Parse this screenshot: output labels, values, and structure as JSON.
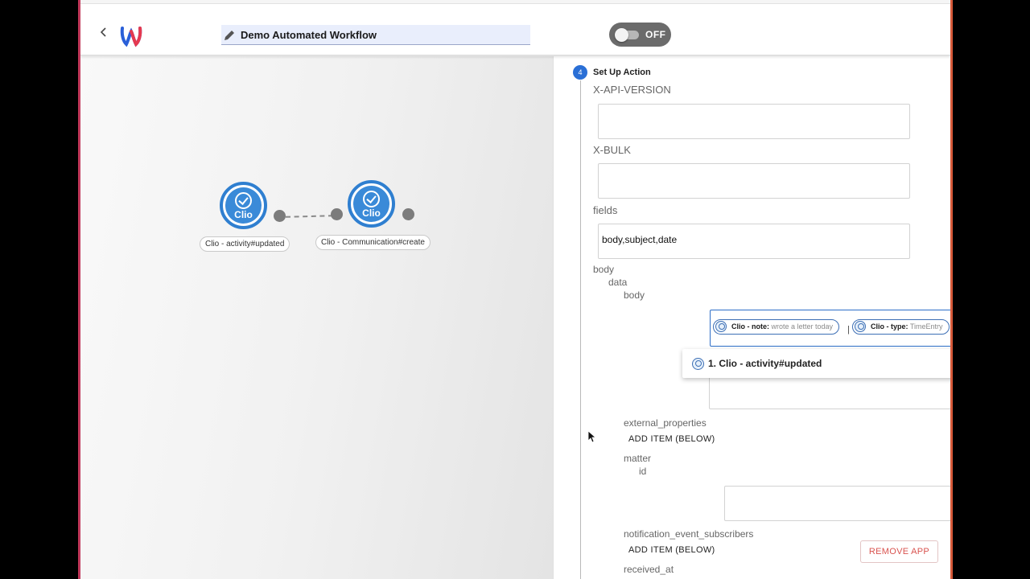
{
  "header": {
    "title_value": "Demo Automated Workflow",
    "toggle_label": "OFF"
  },
  "canvas": {
    "nodes": [
      {
        "icon_text": "Clio",
        "label": "Clio - activity#updated"
      },
      {
        "icon_text": "Clio",
        "label": "Clio - Communication#create"
      }
    ]
  },
  "panel": {
    "step_number": "4",
    "step_title": "Set Up Action",
    "fields": {
      "x_api_version": "X-API-VERSION",
      "x_bulk": "X-BULK",
      "fields_label": "fields",
      "fields_value": "body,subject,date",
      "body": "body",
      "data": "data",
      "data_body": "body",
      "external_properties": "external_properties",
      "matter": "matter",
      "id": "id",
      "notification_event_subscribers": "notification_event_subscribers",
      "received_at": "received_at"
    },
    "chips": [
      {
        "key": "Clio - note:",
        "value": "wrote a letter today"
      },
      {
        "key": "Clio - type:",
        "value": "TimeEntry"
      }
    ],
    "chip_separator": "|",
    "dropdown_label": "1. Clio - activity#updated",
    "add_item_label_1": "ADD ITEM (BELOW)",
    "add_item_label_2": "ADD ITEM (BELOW)",
    "remove_app_label": "REMOVE APP"
  },
  "colors": {
    "accent": "#2a6fd6",
    "node_blue": "#2f7fd0",
    "remove_red": "#d9534f"
  }
}
